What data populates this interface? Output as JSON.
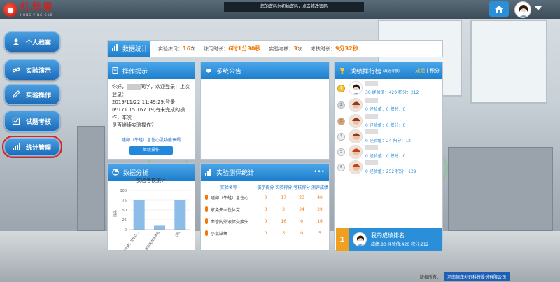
{
  "app": {
    "logo_text": "红苹果",
    "logo_sub": "HONG PING GUO",
    "notice": "您的密码为初始密码，点击修改密码"
  },
  "sidebar": {
    "items": [
      {
        "label": "个人档案",
        "icon": "profile-icon"
      },
      {
        "label": "实验演示",
        "icon": "link-icon"
      },
      {
        "label": "实验操作",
        "icon": "pencil-icon"
      },
      {
        "label": "试题考核",
        "icon": "checklist-icon"
      },
      {
        "label": "统计管理",
        "icon": "bar-chart-icon"
      }
    ]
  },
  "stats": {
    "title": "数据统计",
    "practice_label": "实验练习：",
    "practice_value": "16",
    "practice_unit": "次",
    "practice_time_label": "练习时长：",
    "practice_time_value": "6时1分30秒",
    "exam_label": "实验考核：",
    "exam_value": "3",
    "exam_unit": "次",
    "exam_time_label": "考核时长：",
    "exam_time_value": "9分32秒"
  },
  "tips": {
    "title": "操作提示",
    "text_prefix": "你好，",
    "text_suffix": "同学，欢迎登录！上次登录：",
    "last_login_time": "2019/11/22 11:49:29,登录",
    "ip_line": "IP:171.15.167.19,有未完成的操作，本次",
    "question": "是否继续实验操作？",
    "experiment_link": "嗜卵（牛蛙）急性心肌功能衰竭",
    "continue_button": "继续操作"
  },
  "announcement": {
    "title": "系统公告"
  },
  "ranking": {
    "title": "成绩排行榜",
    "title_sub": "(最近考核)",
    "tab_score": "成绩",
    "tab_points": "积分",
    "rows": [
      {
        "score": "30",
        "exp_label": "经验值：",
        "exp": "420",
        "pts_label": "积分：",
        "pts": "212"
      },
      {
        "score": "0",
        "exp_label": "经验值：",
        "exp": "0",
        "pts_label": "积分：",
        "pts": "0"
      },
      {
        "score": "0",
        "exp_label": "经验值：",
        "exp": "0",
        "pts_label": "积分：",
        "pts": "0"
      },
      {
        "score": "0",
        "exp_label": "经验值：",
        "exp": "24",
        "pts_label": "积分：",
        "pts": "12"
      },
      {
        "score": "0",
        "exp_label": "经验值：",
        "exp": "0",
        "pts_label": "积分：",
        "pts": "0"
      },
      {
        "score": "0",
        "exp_label": "经验值：",
        "exp": "252",
        "pts_label": "积分：",
        "pts": "129"
      }
    ],
    "my_rank_title": "我的成绩排名",
    "my_rank_num": "1",
    "my_score_label": "成绩:",
    "my_score": "80",
    "my_exp_label": "经验值:",
    "my_exp": "420",
    "my_pts_label": "积分:",
    "my_pts": "212"
  },
  "analysis": {
    "title": "数据分析",
    "chart_title": "实验考核统计"
  },
  "chart_data": {
    "type": "bar",
    "title": "实验考核统计",
    "ylabel": "成绩",
    "categories": [
      "嗜卵（牛蛙）急性心...",
      "家兔失血性休克",
      "心肌"
    ],
    "values": [
      75,
      10,
      75
    ],
    "ylim": [
      0,
      100
    ],
    "yticks": [
      "100",
      "75",
      "50",
      "25",
      "0"
    ],
    "color": "#8bbde8"
  },
  "experiments": {
    "title": "实验测评统计",
    "more": "•••",
    "columns": [
      "实验名称",
      "演示得分",
      "实验得分",
      "考核得分",
      "测评成绩"
    ],
    "rows": [
      [
        "嗜卵（牛蛙）急性心...",
        "0",
        "17",
        "23",
        "40"
      ],
      [
        "家兔失血性休克",
        "3",
        "2",
        "24",
        "29"
      ],
      [
        "血管内外液体交换失...",
        "0",
        "16",
        "0",
        "16"
      ],
      [
        "小鼠缺氧",
        "0",
        "5",
        "0",
        "5"
      ]
    ]
  },
  "footer": {
    "copyright": "版权所有：",
    "company": "河南恒茂创远科技股份有限公司"
  }
}
